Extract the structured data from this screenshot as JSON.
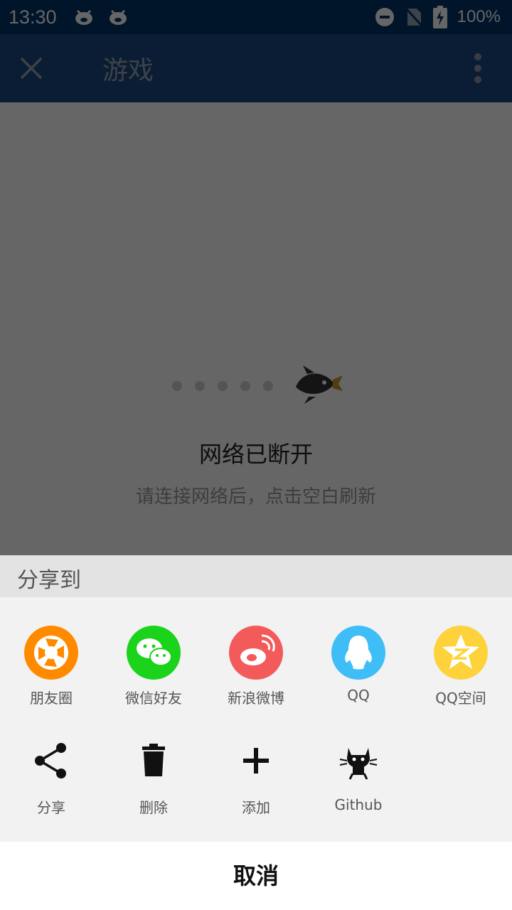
{
  "status_bar": {
    "time": "13:30",
    "battery": "100%"
  },
  "app_bar": {
    "title": "游戏"
  },
  "error": {
    "title": "网络已断开",
    "subtitle": "请连接网络后，点击空白刷新"
  },
  "sheet": {
    "title": "分享到",
    "share_targets": [
      {
        "label": "朋友圈",
        "icon": "moments-icon",
        "color": "#ff8a00"
      },
      {
        "label": "微信好友",
        "icon": "wechat-icon",
        "color": "#1ad31a"
      },
      {
        "label": "新浪微博",
        "icon": "weibo-icon",
        "color": "#f35a5a"
      },
      {
        "label": "QQ",
        "icon": "qq-icon",
        "color": "#3fbdf6"
      },
      {
        "label": "QQ空间",
        "icon": "qzone-icon",
        "color": "#fdd23b"
      }
    ],
    "actions": [
      {
        "label": "分享",
        "icon": "share-icon"
      },
      {
        "label": "删除",
        "icon": "trash-icon"
      },
      {
        "label": "添加",
        "icon": "add-icon"
      },
      {
        "label": "Github",
        "icon": "github-icon"
      }
    ],
    "cancel_label": "取消"
  }
}
